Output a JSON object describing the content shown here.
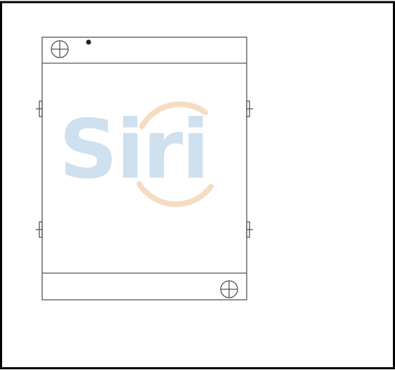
{
  "drawing": {
    "subject": "radiator-core-outline",
    "line_color": "#555555",
    "frame_color": "#000000",
    "inlet_fittings": 1,
    "outlet_fittings": 1,
    "mounting_brackets_per_side": 2,
    "side_views_shown": [
      "left",
      "right"
    ]
  },
  "watermark": {
    "text": "Siri",
    "letter_color": "#cfe0ee",
    "arc_color": "#f6dcc3"
  }
}
